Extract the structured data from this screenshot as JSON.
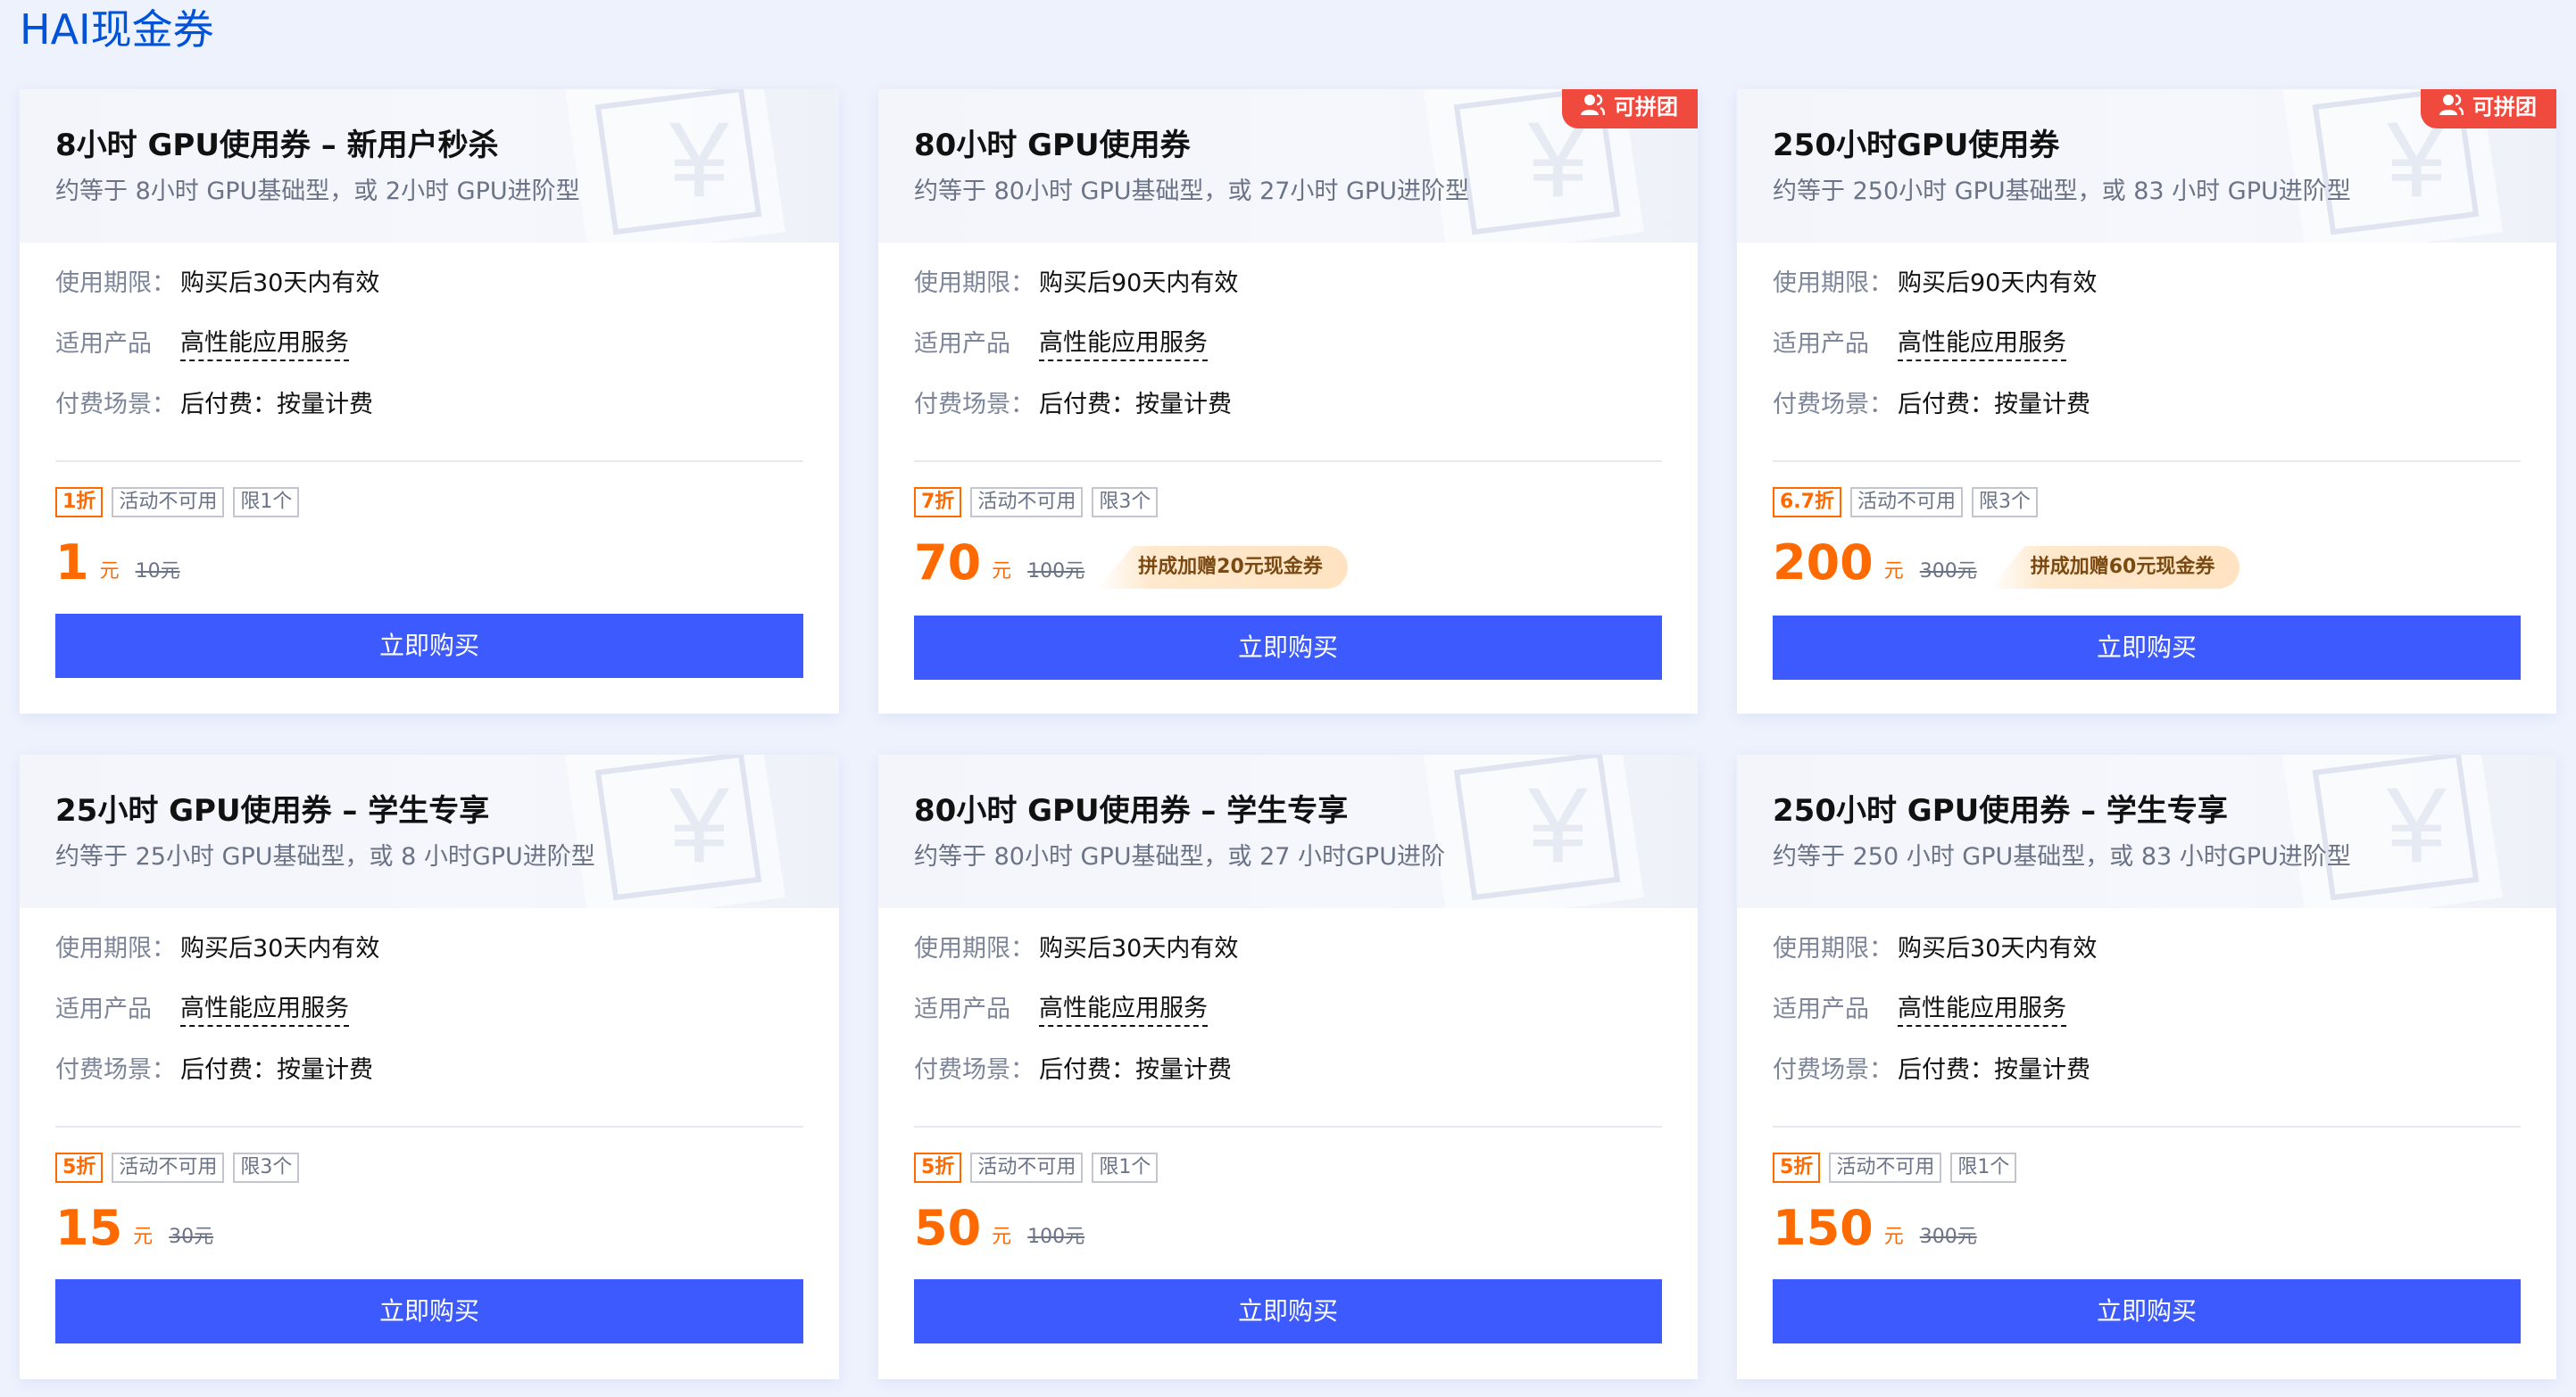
{
  "page": {
    "title": "HAI现金券"
  },
  "labels": {
    "validity": "使用期限：",
    "product": "适用产品",
    "payment": "付费场景：",
    "unit": "元"
  },
  "cards": [
    {
      "title": "8小时 GPU使用券 – 新用户秒杀",
      "subtitle": "约等于 8小时 GPU基础型，或 2小时 GPU进阶型",
      "group_tag": null,
      "validity": "购买后30天内有效",
      "product": "高性能应用服务",
      "payment": "后付费：按量计费",
      "badges": [
        "1折",
        "活动不可用",
        "限1个"
      ],
      "price": "1",
      "original_price": "10元",
      "bonus": null,
      "button": "立即购买"
    },
    {
      "title": "80小时 GPU使用券",
      "subtitle": "约等于 80小时 GPU基础型，或 27小时 GPU进阶型",
      "group_tag": "可拼团",
      "validity": "购买后90天内有效",
      "product": "高性能应用服务",
      "payment": "后付费：按量计费",
      "badges": [
        "7折",
        "活动不可用",
        "限3个"
      ],
      "price": "70",
      "original_price": "100元",
      "bonus": "拼成加赠20元现金券",
      "button": "立即购买"
    },
    {
      "title": "250小时GPU使用券",
      "subtitle": "约等于 250小时 GPU基础型，或 83 小时 GPU进阶型",
      "group_tag": "可拼团",
      "validity": "购买后90天内有效",
      "product": "高性能应用服务",
      "payment": "后付费：按量计费",
      "badges": [
        "6.7折",
        "活动不可用",
        "限3个"
      ],
      "price": "200",
      "original_price": "300元",
      "bonus": "拼成加赠60元现金券",
      "button": "立即购买"
    },
    {
      "title": "25小时 GPU使用券 – 学生专享",
      "subtitle": "约等于 25小时 GPU基础型，或 8 小时GPU进阶型",
      "group_tag": null,
      "validity": "购买后30天内有效",
      "product": "高性能应用服务",
      "payment": "后付费：按量计费",
      "badges": [
        "5折",
        "活动不可用",
        "限3个"
      ],
      "price": "15",
      "original_price": "30元",
      "bonus": null,
      "button": "立即购买"
    },
    {
      "title": "80小时 GPU使用券 – 学生专享",
      "subtitle": "约等于 80小时 GPU基础型，或 27 小时GPU进阶",
      "group_tag": null,
      "validity": "购买后30天内有效",
      "product": "高性能应用服务",
      "payment": "后付费：按量计费",
      "badges": [
        "5折",
        "活动不可用",
        "限1个"
      ],
      "price": "50",
      "original_price": "100元",
      "bonus": null,
      "button": "立即购买"
    },
    {
      "title": "250小时 GPU使用券 – 学生专享",
      "subtitle": "约等于 250 小时 GPU基础型，或 83 小时GPU进阶型",
      "group_tag": null,
      "validity": "购买后30天内有效",
      "product": "高性能应用服务",
      "payment": "后付费：按量计费",
      "badges": [
        "5折",
        "活动不可用",
        "限1个"
      ],
      "price": "150",
      "original_price": "300元",
      "bonus": null,
      "button": "立即购买"
    }
  ],
  "colors": {
    "accent": "#3d5afe",
    "price": "#ff6a00",
    "group_tag": "#f0493e",
    "title_blue": "#0052d9"
  }
}
